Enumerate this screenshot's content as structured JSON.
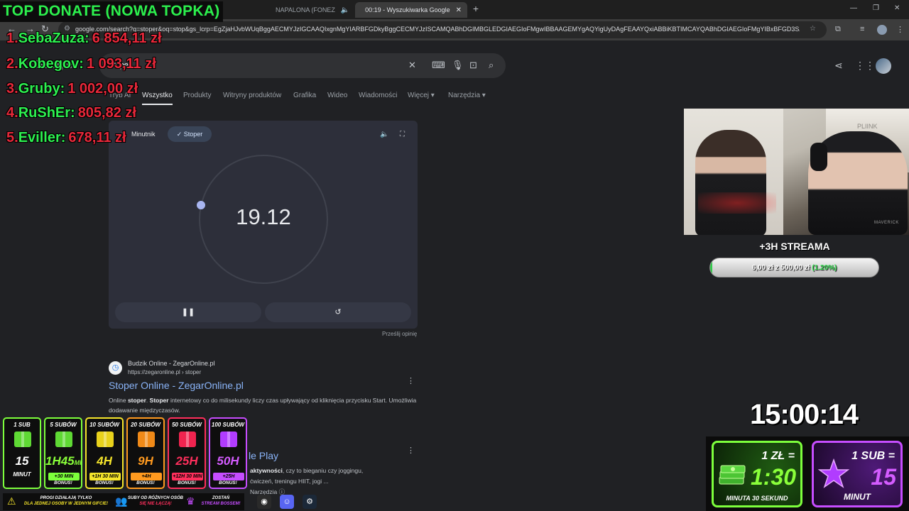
{
  "browser": {
    "tabs": [
      {
        "title": "NAPALONA (FONEZ",
        "active": false
      },
      {
        "title": "00:19 - Wyszukiwarka Google",
        "active": true
      }
    ],
    "url": "google.com/search?q=stoper&oq=stop&gs_lcrp=EgZjaHJvbWUqBggAECMYJzIGCAAQIxgnMgYIARBFGDkyBggCECMYJzISCAMQABhDGIMBGLEDGIAEGIoFMgwIBBAAGEMYgAQYigUyDAgFEAAYQxiABBiKBTIMCAYQABhDGIAEGIoFMgYIBxBFGD3SAQc1"
  },
  "google": {
    "logo": "Google",
    "query": "stoper",
    "nav": [
      "Tryb AI",
      "Wszystko",
      "Produkty",
      "Witryny produktów",
      "Grafika",
      "Wideo",
      "Wiadomości",
      "Więcej",
      "Narzędzia"
    ],
    "widget": {
      "tab_timer": "Minutnik",
      "tab_stopwatch": "Stoper",
      "time": "19.12",
      "feedback": "Prześlij opinię"
    },
    "result1": {
      "site": "Budzik Online - ZegarOnline.pl",
      "url": "https://zegaronline.pl › stoper",
      "title": "Stoper Online - ZegarOnline.pl",
      "snippet_a": "Online ",
      "snippet_b": "stoper",
      "snippet_c": ". ",
      "snippet_d": "Stoper",
      "snippet_e": " internetowy co do milisekundy liczy czas upływający od kliknięcia przycisku Start. Umożliwia dodawanie międzyczasów."
    },
    "result2": {
      "title": "le Play",
      "snippet_a": "aktywności",
      "snippet_b": ", czy to bieganiu czy joggingu,",
      "snippet_c": "ćwiczeń, treningu HIIT, jogi ...",
      "snippet_d": "Narzędzia"
    }
  },
  "overlay": {
    "top_donate_title": "TOP DONATE (NOWA TOPKA)",
    "donors": [
      {
        "rank": "1.",
        "name": "SebaZuza:",
        "amount": "6 854,11 zł"
      },
      {
        "rank": "2.",
        "name": "Kobegov:",
        "amount": "1 093,11 zł"
      },
      {
        "rank": "3.",
        "name": "Gruby:",
        "amount": "1 002,00 zł"
      },
      {
        "rank": "4.",
        "name": "RuShEr:",
        "amount": "805,82 zł"
      },
      {
        "rank": "5.",
        "name": "Eviller:",
        "amount": "678,11 zł"
      }
    ],
    "webcam_wall_text": "PLIINK",
    "webcam_shirt_text": "MAVERICK",
    "goal": {
      "title": "+3H STREAMA",
      "current": "6,00 zł",
      "sep": "z",
      "target": "500,00 zł",
      "percent_text": "(1.20%)",
      "progress": 0.012
    },
    "timer": "15:00:14",
    "rate_money": {
      "l1": "1 ZŁ =",
      "l2": "1:30",
      "l3": "MINUTA 30 SEKUND"
    },
    "rate_sub": {
      "l1": "1 SUB =",
      "l2": "15",
      "l3": "MINUT"
    },
    "tiers": [
      {
        "head": "1 SUB",
        "val": "15",
        "foot": "MINUT",
        "bonus": "",
        "color": "#7dff3c"
      },
      {
        "head": "5 SUBÓW",
        "val": "1H45",
        "unit": "MIN",
        "bonus": "+30 MIN",
        "foot": "BONUS!",
        "color": "#7dff3c"
      },
      {
        "head": "10 SUBÓW",
        "val": "4H",
        "bonus": "+1H 30 MIN",
        "foot": "BONUS!",
        "color": "#f5e52b"
      },
      {
        "head": "20 SUBÓW",
        "val": "9H",
        "bonus": "+4H",
        "foot": "BONUS!",
        "color": "#ff9a1f"
      },
      {
        "head": "50 SUBÓW",
        "val": "25H",
        "bonus": "+12H 30 MIN",
        "foot": "BONUS!",
        "color": "#ff2f5c"
      },
      {
        "head": "100 SUBÓW",
        "val": "50H",
        "bonus": "+25H",
        "foot": "BONUS!",
        "color": "#c64dff"
      }
    ],
    "notes": [
      {
        "l1": "PROGI DZIAŁAJĄ TYLKO",
        "l2": "DLA JEDNEJ OSOBY W JEDNYM GIFCIE!"
      },
      {
        "l1": "SUBY OD RÓŻNYCH OSÓB",
        "l2": "SIĘ NIE ŁĄCZĄ!"
      },
      {
        "l1": "ZOSTAŃ",
        "l2": "STREAM BOSSEM!"
      }
    ]
  }
}
